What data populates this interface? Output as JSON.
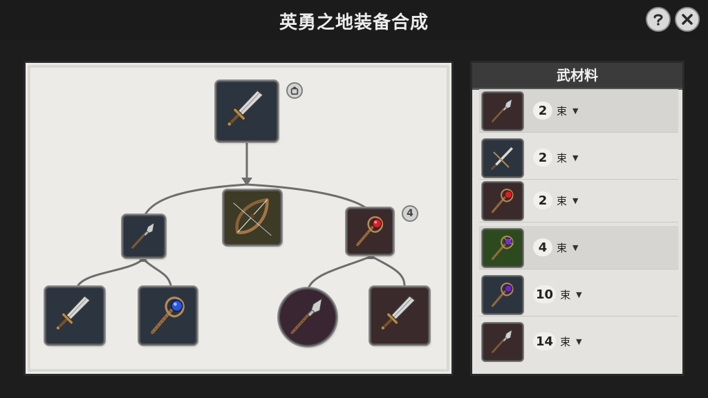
{
  "window": {
    "title": "英勇之地装备合成",
    "icons": {
      "help": "help-icon",
      "close": "close-icon"
    }
  },
  "tree": {
    "top_badge": "",
    "right_badge": "4",
    "nodes": {
      "root": "steel-sword",
      "mid_left": "spear",
      "mid_center": "bow",
      "mid_right": "ruby-staff",
      "leaf_1": "iron-sword",
      "leaf_2": "sapphire-staff",
      "leaf_3": "spear",
      "leaf_4": "iron-sword"
    }
  },
  "materials": {
    "header": "武材料",
    "items": [
      {
        "icon": "spear",
        "count": "2",
        "unit": "束"
      },
      {
        "icon": "sword",
        "count": "2",
        "unit": "束"
      },
      {
        "icon": "ruby-staff",
        "count": "2",
        "unit": "束"
      },
      {
        "icon": "amethyst-staff",
        "count": "4",
        "unit": "束"
      },
      {
        "icon": "violet-staff",
        "count": "10",
        "unit": "束"
      },
      {
        "icon": "spear",
        "count": "14",
        "unit": "束"
      }
    ]
  },
  "colors": {
    "board": "#ecebe7",
    "slot_frame": "#8a8a8a",
    "ruby": "#d8202a",
    "sapphire": "#2b57d6",
    "amethyst": "#7a2fc0",
    "wood": "#a37646"
  }
}
